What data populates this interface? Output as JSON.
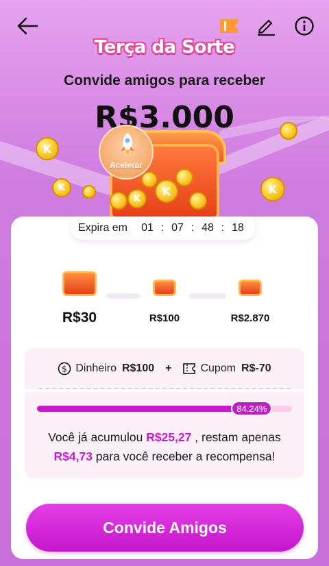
{
  "header": {
    "back_icon": "arrow-left-icon",
    "ticket_icon": "ticket-icon",
    "edit_icon": "pencil-icon",
    "info_icon": "info-icon",
    "title": "Terça da Sorte"
  },
  "hero": {
    "subtitle": "Convide amigos para receber",
    "amount": "R$3.000",
    "accelerate_label": "Acelerar"
  },
  "timer": {
    "label": "Expira em",
    "days": "01",
    "hours": "07",
    "minutes": "48",
    "seconds": "18",
    "sep": ":"
  },
  "tiers": [
    {
      "label": "R$30"
    },
    {
      "label": "R$100"
    },
    {
      "label": "R$2.870"
    }
  ],
  "breakdown": {
    "cash_label": "Dinheiro",
    "cash_value": "R$100",
    "plus": "+",
    "coupon_label": "Cupom",
    "coupon_value": "R$-70"
  },
  "progress": {
    "percent_label": "84.24%",
    "fraction": 0.8424,
    "msg_part1": "Você já acumulou ",
    "accumulated": "R$25,27",
    "msg_part2": " , restam apenas",
    "remaining": "R$4,73",
    "msg_part3": " para você receber a recompensa!"
  },
  "cta": {
    "label": "Convide Amigos"
  },
  "colors": {
    "accent": "#c11ec8",
    "background": "#d98ce6"
  }
}
